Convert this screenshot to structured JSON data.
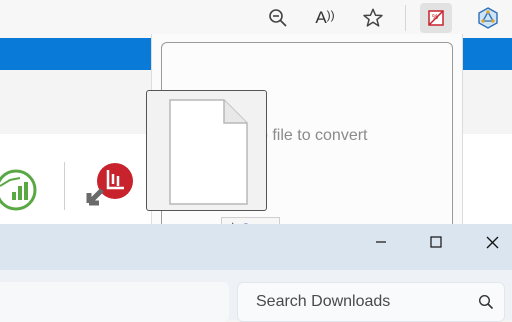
{
  "toolbar": {
    "buttons": [
      {
        "name": "zoom-out",
        "icon": "zoom-out-icon"
      },
      {
        "name": "read-aloud",
        "icon": "read-aloud-icon",
        "text": "A"
      },
      {
        "name": "favorites",
        "icon": "star-icon"
      },
      {
        "name": "extension",
        "icon": "pdf-convert-icon",
        "active": true
      },
      {
        "name": "profile",
        "icon": "shield-logo-icon"
      }
    ]
  },
  "popup": {
    "dropzone_text": "p file to convert"
  },
  "drag": {
    "copy_label": "Copy",
    "copy_symbol": "+"
  },
  "downloads": {
    "search_placeholder": "Search Downloads"
  },
  "colors": {
    "accent_blue": "#0a7ad8",
    "extension_red": "#c8232c",
    "app_green": "#5aa844",
    "copy_text": "#2a4bb5"
  }
}
